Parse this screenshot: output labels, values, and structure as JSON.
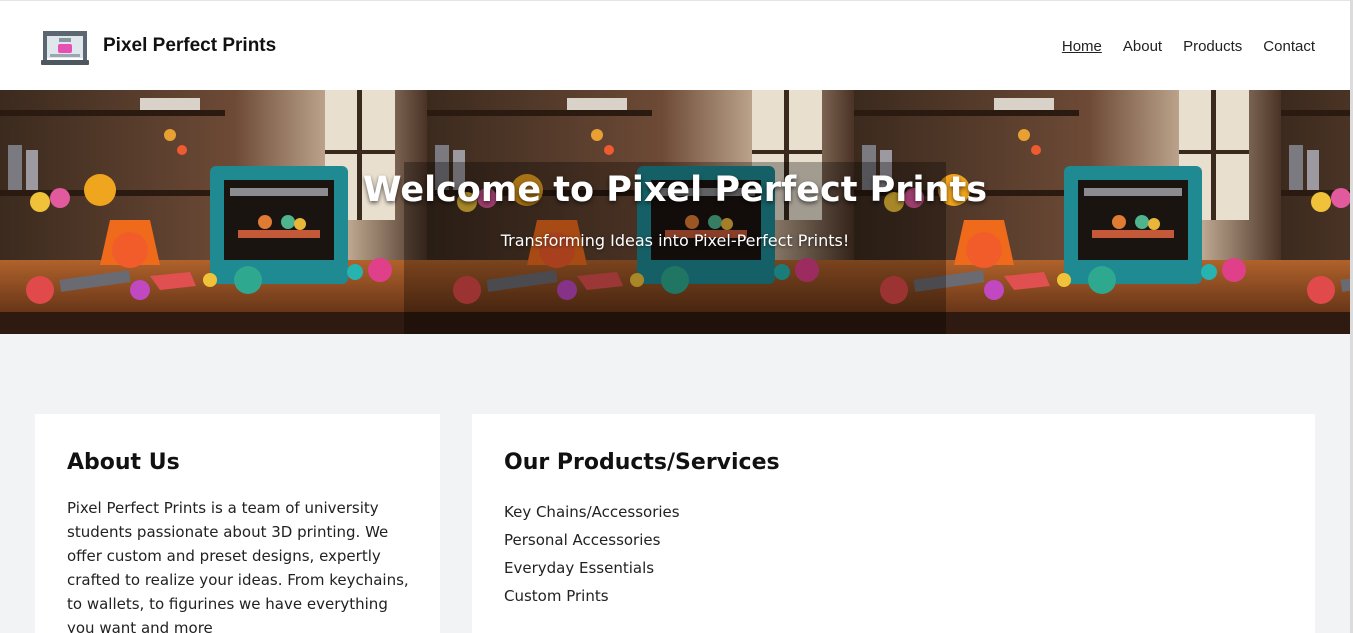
{
  "header": {
    "brand": "Pixel Perfect Prints",
    "logo_icon": "3d-printer-icon",
    "nav": [
      {
        "label": "Home",
        "active": true
      },
      {
        "label": "About",
        "active": false
      },
      {
        "label": "Products",
        "active": false
      },
      {
        "label": "Contact",
        "active": false
      }
    ]
  },
  "hero": {
    "title": "Welcome to Pixel Perfect Prints",
    "subtitle": "Transforming Ideas into Pixel-Perfect Prints!",
    "image_icon": "3d-printer-workshop-image"
  },
  "about": {
    "heading": "About Us",
    "text": "Pixel Perfect Prints is a team of university students passionate about 3D printing. We offer custom and preset designs, expertly crafted to realize your ideas. From keychains, to wallets, to figurines we have everything you want and more"
  },
  "products": {
    "heading": "Our Products/Services",
    "items": [
      "Key Chains/Accessories",
      "Personal Accessories",
      "Everyday Essentials",
      "Custom Prints"
    ]
  },
  "colors": {
    "page_bg": "#f2f3f5",
    "card_bg": "#ffffff",
    "printer_teal": "#1f8a92"
  }
}
